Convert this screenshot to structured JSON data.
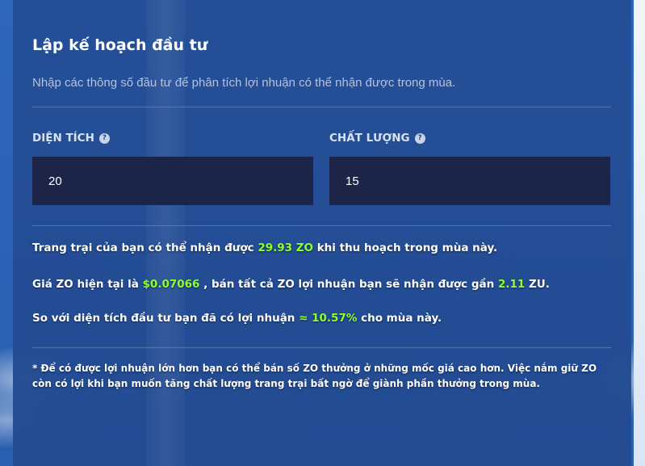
{
  "planner": {
    "title": "Lập kế hoạch đầu tư",
    "subtitle": "Nhập các thông số đầu tư để phân tích lợi nhuận có thể nhận được trong mùa.",
    "area": {
      "label": "DIỆN TÍCH",
      "value": "20"
    },
    "quality": {
      "label": "CHẤT LƯỢNG",
      "value": "15"
    },
    "help_glyph": "?",
    "result1": {
      "prefix": "Trang trại của bạn có thể nhận được",
      "amount": "29.93 ZO",
      "suffix": "khi thu hoạch trong mùa này."
    },
    "result2": {
      "prefix": "Giá ZO hiện tại là",
      "price": "$0.07066",
      "middle": ", bán tất cả ZO lợi nhuận bạn sẽ nhận được gần",
      "amount": "2.11",
      "suffix": "ZU."
    },
    "result3": {
      "prefix": "So với diện tích đầu tư bạn đã có lợi nhuận",
      "percent": "≈ 10.57%",
      "suffix": "cho mùa này."
    },
    "note": "* Để có được lợi nhuận lớn hơn bạn có thể bán số ZO thưởng ở những mốc giá cao hơn. Việc nắm giữ ZO còn có lợi khi bạn muốn tăng chất lượng trang trại bất ngờ để giành phần thưởng trong mùa."
  },
  "colors": {
    "highlight": "#8dff2e",
    "input_bg": "#1c2447",
    "panel_bg": "#244e96"
  }
}
